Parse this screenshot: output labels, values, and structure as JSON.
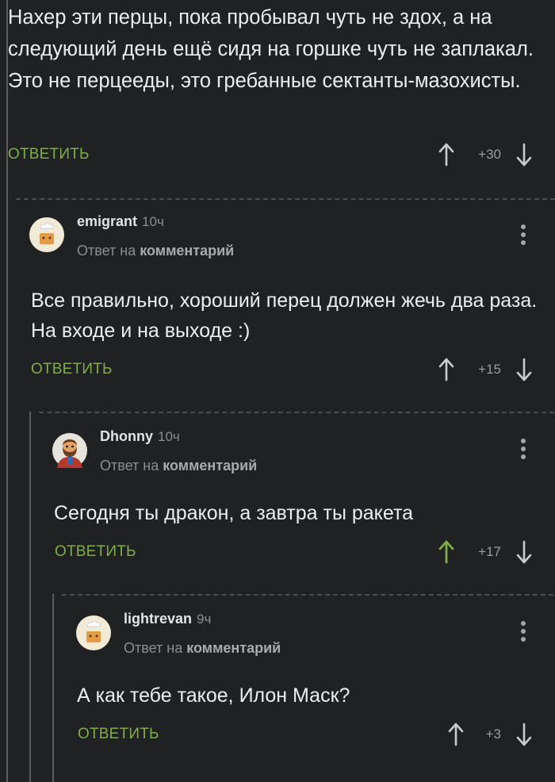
{
  "top_comment": {
    "text": "Нахер эти перцы, пока пробывал чуть не здох, а на следующий день ещё сидя на горшке чуть не заплакал. Это не перцееды, это гребанные сектанты-мазохисты.",
    "reply_label": "ОТВЕТИТЬ",
    "score": "+30"
  },
  "comments": [
    {
      "username": "emigrant",
      "time": "10ч",
      "answer_prefix": "Ответ на",
      "answer_link": "комментарий",
      "text": "Все правильно, хороший перец должен жечь два раза. На входе и на выходе :)",
      "reply_label": "ОТВЕТИТЬ",
      "score": "+15",
      "avatar": "chef-avatar-icon"
    },
    {
      "username": "Dhonny",
      "time": "10ч",
      "answer_prefix": "Ответ на",
      "answer_link": "комментарий",
      "text": "Сегодня ты дракон, а завтра ты ракета",
      "reply_label": "ОТВЕТИТЬ",
      "score": "+17",
      "upvoted": true,
      "avatar": "bearded-man-avatar-icon"
    },
    {
      "username": "lightrevan",
      "time": "9ч",
      "answer_prefix": "Ответ на",
      "answer_link": "комментарий",
      "text": "А как тебе такое, Илон Маск?",
      "reply_label": "ОТВЕТИТЬ",
      "score": "+3",
      "avatar": "chef-avatar-icon"
    }
  ],
  "colors": {
    "background": "#1f2123",
    "accent_green": "#7fae49",
    "text": "#ededed",
    "muted": "#8b8d8f"
  }
}
